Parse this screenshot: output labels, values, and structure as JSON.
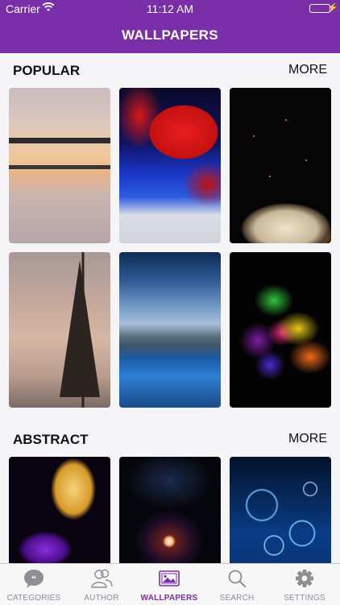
{
  "status_bar": {
    "carrier": "Carrier",
    "time": "11:12 AM"
  },
  "nav": {
    "title": "WALLPAPERS"
  },
  "sections": [
    {
      "title": "POPULAR",
      "more": "MORE"
    },
    {
      "title": "ABSTRACT",
      "more": "MORE"
    }
  ],
  "tabs": [
    {
      "label": "CATEGORIES",
      "icon": "quote-bubble-icon"
    },
    {
      "label": "AUTHOR",
      "icon": "users-icon"
    },
    {
      "label": "WALLPAPERS",
      "icon": "image-icon",
      "active": true
    },
    {
      "label": "SEARCH",
      "icon": "search-icon"
    },
    {
      "label": "SETTINGS",
      "icon": "gear-icon"
    }
  ],
  "colors": {
    "brand": "#7a2ea8",
    "tab_inactive": "#8e8e93",
    "battery": "#4cd964"
  }
}
